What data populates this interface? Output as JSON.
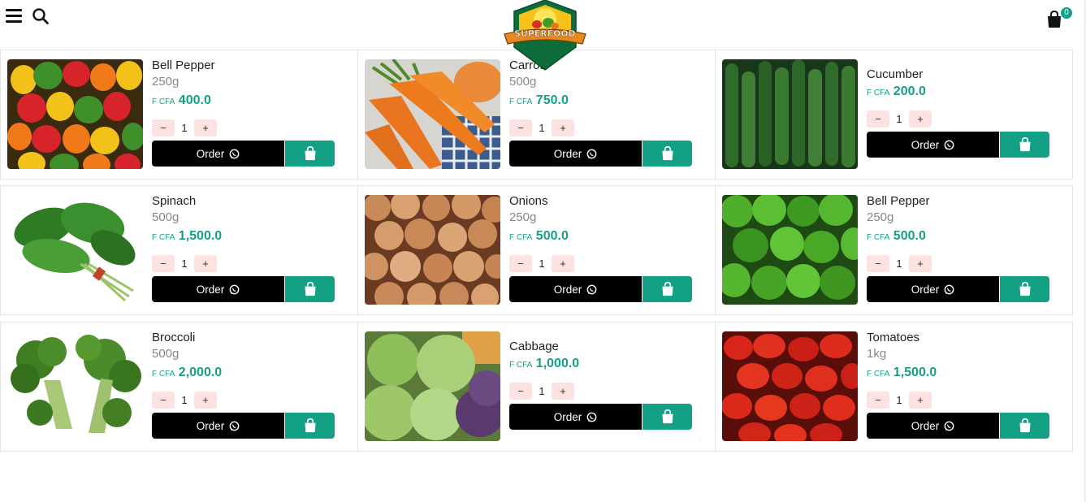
{
  "header": {
    "menu_icon": "hamburger-menu-icon",
    "search_icon": "search-icon",
    "logo_text": "SUPERFOOD",
    "cart_icon": "shopping-bag-icon",
    "cart_count": "0"
  },
  "colors": {
    "accent": "#14a085",
    "order_button": "#000000",
    "qty_button": "#fde2e2"
  },
  "labels": {
    "order": "Order",
    "minus": "−",
    "plus": "+"
  },
  "products": [
    {
      "name": "Bell Pepper",
      "weight": "250g",
      "currency": "F CFA",
      "price": "400.0",
      "qty": "1",
      "image": "bell-pepper-mixed"
    },
    {
      "name": "Carrot",
      "weight": "500g",
      "currency": "F CFA",
      "price": "750.0",
      "qty": "1",
      "image": "carrot"
    },
    {
      "name": "Cucumber",
      "weight": "",
      "currency": "F CFA",
      "price": "200.0",
      "qty": "1",
      "image": "cucumber"
    },
    {
      "name": "Spinach",
      "weight": "500g",
      "currency": "F CFA",
      "price": "1,500.0",
      "qty": "1",
      "image": "spinach"
    },
    {
      "name": "Onions",
      "weight": "250g",
      "currency": "F CFA",
      "price": "500.0",
      "qty": "1",
      "image": "onions"
    },
    {
      "name": "Bell Pepper",
      "weight": "250g",
      "currency": "F CFA",
      "price": "500.0",
      "qty": "1",
      "image": "bell-pepper-green"
    },
    {
      "name": "Broccoli",
      "weight": "500g",
      "currency": "F CFA",
      "price": "2,000.0",
      "qty": "1",
      "image": "broccoli"
    },
    {
      "name": "Cabbage",
      "weight": "",
      "currency": "F CFA",
      "price": "1,000.0",
      "qty": "1",
      "image": "cabbage"
    },
    {
      "name": "Tomatoes",
      "weight": "1kg",
      "currency": "F CFA",
      "price": "1,500.0",
      "qty": "1",
      "image": "tomatoes"
    }
  ]
}
